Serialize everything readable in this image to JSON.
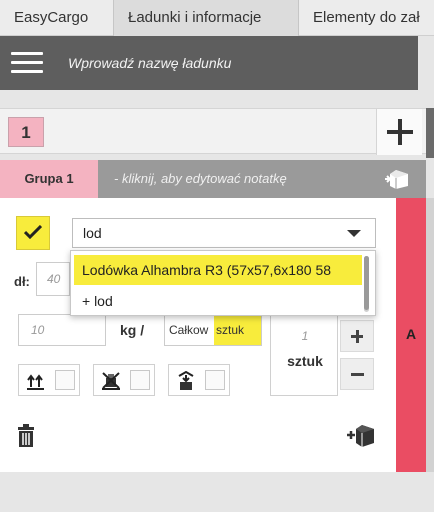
{
  "tabs": [
    {
      "label": "EasyCargo"
    },
    {
      "label": "Ładunki i informacje"
    },
    {
      "label": "Elementy do zał"
    }
  ],
  "header": {
    "title": "Wprowadź nazwę ładunku"
  },
  "counter": {
    "value": "1"
  },
  "group": {
    "label": "Grupa 1",
    "note": "- kliknij, aby edytować notatkę"
  },
  "item": {
    "search_value": "lod",
    "length_label": "dł:",
    "length_placeholder": "40",
    "weight_placeholder": "10",
    "weight_unit": "kg /",
    "total_label": "Całkow",
    "total_unit": "sztuk",
    "quantity_placeholder": "1",
    "quantity_unit": "sztuk",
    "side_label": "A"
  },
  "dropdown": {
    "options": [
      {
        "label": "Lodówka Alhambra R3 (57x57,6x180 58"
      },
      {
        "label": "+ lod"
      }
    ]
  },
  "colors": {
    "accent_yellow": "#f8ec3c",
    "group_pink": "#f4b3c1",
    "side_red": "#ea4d63",
    "header_gray": "#5e5e5e"
  },
  "icons": {
    "menu": "hamburger-icon",
    "add": "plus-icon",
    "package": "package-arrow-icon",
    "check": "check-icon",
    "caret": "chevron-down-icon",
    "stack": "stackable-icon",
    "no_tilt": "no-stack-icon",
    "this_side_up": "top-load-icon",
    "delete": "trash-icon",
    "add_package": "add-package-icon"
  }
}
